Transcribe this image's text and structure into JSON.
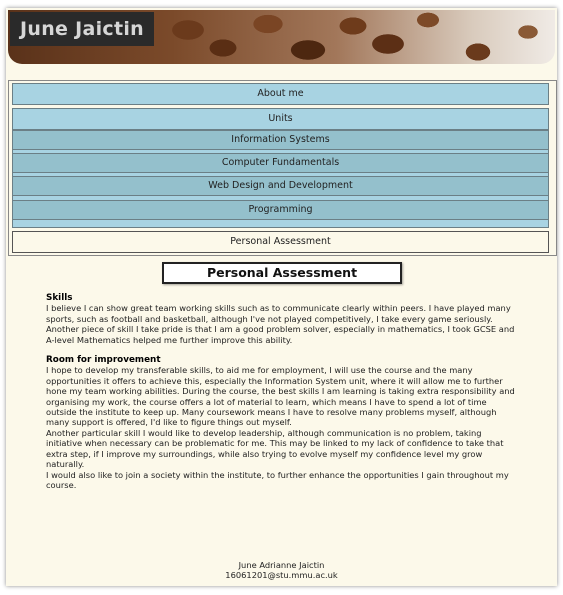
{
  "banner": {
    "title": "June Jaictin"
  },
  "nav": {
    "about": "About me",
    "units": "Units",
    "unit_items": [
      "Information Systems",
      "Computer Fundamentals",
      "Web Design and Development",
      "Programming"
    ],
    "current": "Personal Assessment"
  },
  "main": {
    "title": "Personal Assessment",
    "sections": [
      {
        "heading": "Skills",
        "paragraphs": [
          "I believe I can show great team working skills such as to communicate clearly within peers. I have played many sports, such as football and basketball, although I've not played competitively, I take every game seriously.",
          "Another piece of skill I take pride is that I am a good problem solver, especially in mathematics, I took GCSE and A-level Mathematics helped me further improve this ability."
        ]
      },
      {
        "heading": "Room for improvement",
        "paragraphs": [
          "I hope to develop my transferable skills, to aid me for employment, I will use the course and the many opportunities it offers to achieve this, especially the Information System unit, where it will allow me to further hone my team working abilities. During the course, the best skills I am learning is taking extra responsibility and organising my work, the course offers a lot of material to learn, which means I have to spend a lot of time outside the institute to keep up. Many coursework means I have to resolve many problems myself, although many support is offered, I'd like to figure things out myself.",
          "Another particular skill I would like to develop leadership, although communication is no problem, taking initiative when necessary can be problematic for me. This may be linked to my lack of confidence to take that extra step, if I improve my surroundings, while also trying to evolve myself my confidence level my grow naturally.",
          "I would also like to join a society within the institute, to further enhance the opportunities I gain throughout my course."
        ]
      }
    ]
  },
  "footer": {
    "name": "June Adrianne Jaictin",
    "email": "16061201@stu.mmu.ac.uk"
  }
}
